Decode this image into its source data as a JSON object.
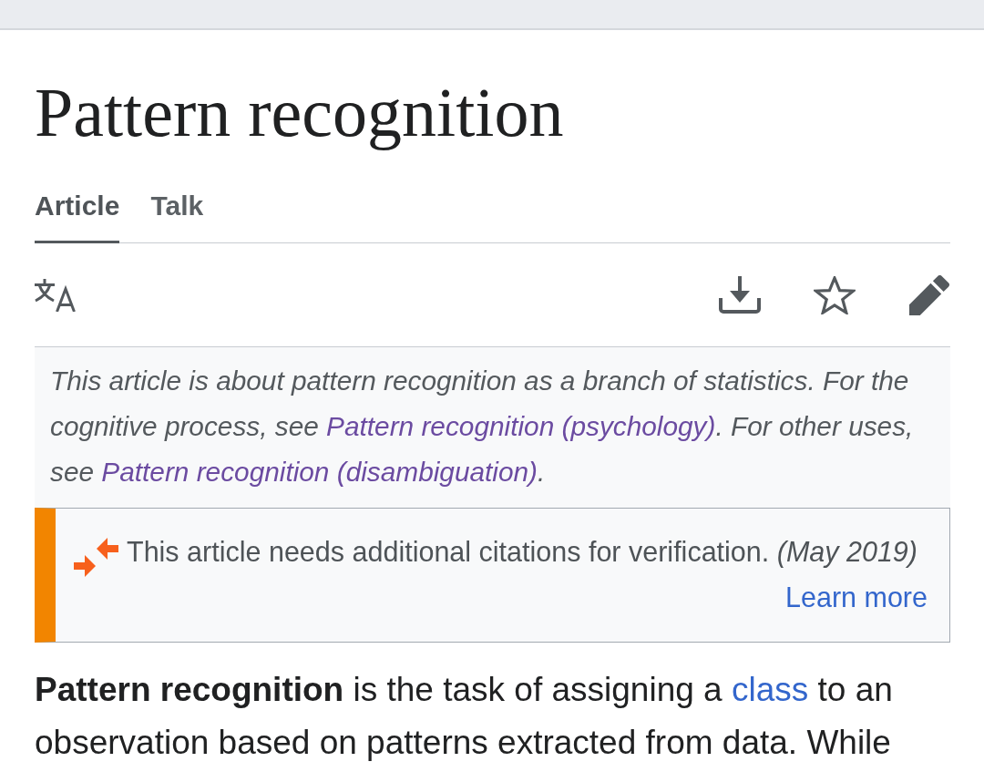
{
  "title": "Pattern recognition",
  "tabs": [
    {
      "label": "Article",
      "selected": true
    },
    {
      "label": "Talk",
      "selected": false
    }
  ],
  "hatnote": {
    "segments": [
      {
        "kind": "text",
        "text": "This article is about pattern recognition as a branch of statistics. For the cognitive process, see "
      },
      {
        "kind": "link",
        "text": "Pattern recognition (psychology)",
        "visited": true
      },
      {
        "kind": "text",
        "text": ". For other uses, see "
      },
      {
        "kind": "link",
        "text": "Pattern recognition (disambiguation)",
        "visited": true
      },
      {
        "kind": "text",
        "text": "."
      }
    ]
  },
  "notice": {
    "message": "This article needs additional citations for verification. *(May 2019)*",
    "link": "Learn more"
  },
  "lead": {
    "segments": [
      {
        "kind": "text",
        "text": "**Pattern recognition** is the task of assigning a "
      },
      {
        "kind": "link",
        "text": "class",
        "visited": false
      },
      {
        "kind": "text",
        "text": " to an observation based on patterns extracted from data. While"
      }
    ]
  }
}
